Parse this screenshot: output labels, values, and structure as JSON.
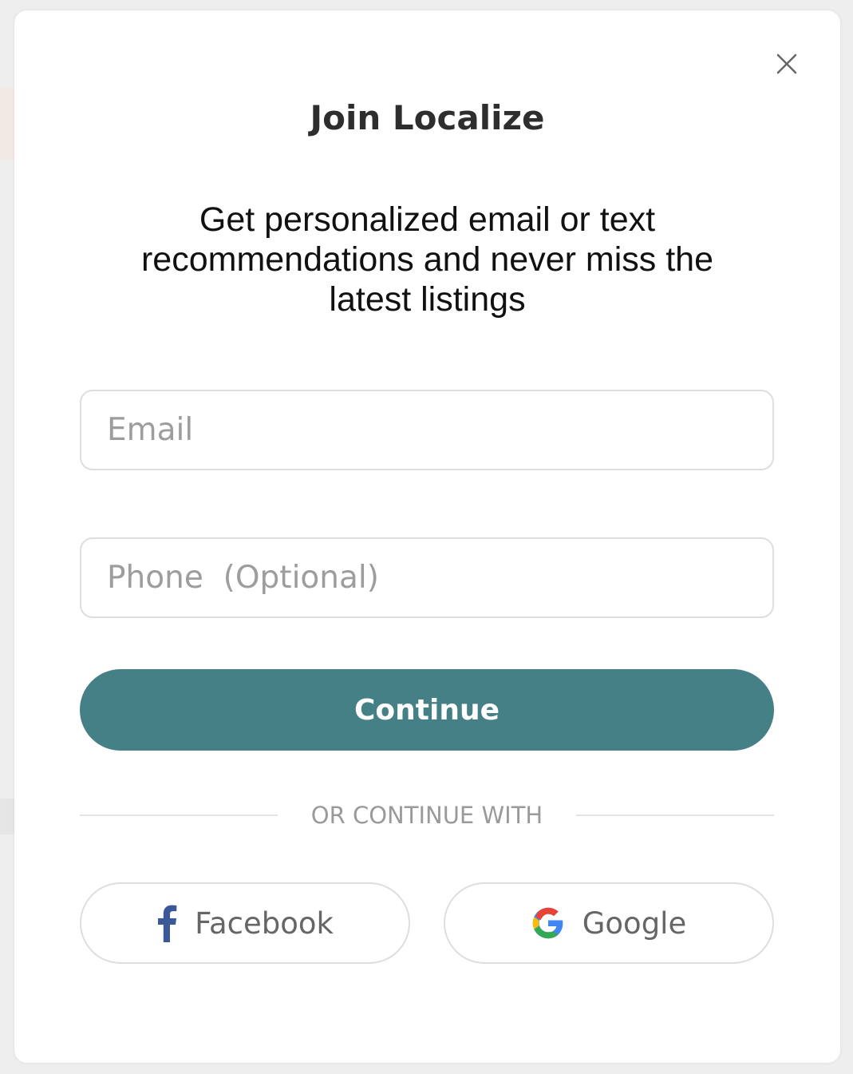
{
  "modal": {
    "title": "Join Localize",
    "subtitle": "Get personalized email or text recommendations and never miss the latest listings",
    "close_icon": "close-icon"
  },
  "form": {
    "email_placeholder": "Email",
    "phone_placeholder": "Phone  (Optional)",
    "continue_label": "Continue"
  },
  "divider": {
    "text": "OR CONTINUE WITH"
  },
  "social": {
    "facebook_label": "Facebook",
    "facebook_icon": "facebook-icon",
    "google_label": "Google",
    "google_icon": "google-icon"
  },
  "colors": {
    "accent": "#448086",
    "facebook_blue": "#3b5998"
  }
}
